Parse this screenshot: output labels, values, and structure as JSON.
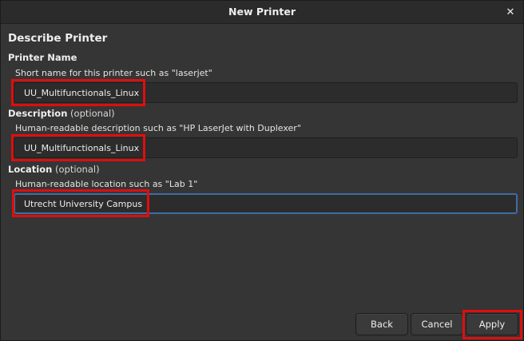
{
  "window": {
    "title": "New Printer",
    "close_symbol": "✕"
  },
  "form": {
    "heading": "Describe Printer",
    "printer_name": {
      "label": "Printer Name",
      "hint": "Short name for this printer such as \"laserjet\"",
      "value": "UU_Multifunctionals_Linux"
    },
    "description": {
      "label": "Description",
      "optional": " (optional)",
      "hint": "Human-readable description such as \"HP LaserJet with Duplexer\"",
      "value": "UU_Multifunctionals_Linux"
    },
    "location": {
      "label": "Location",
      "optional": " (optional)",
      "hint": "Human-readable location such as \"Lab 1\"",
      "value": "Utrecht University Campus"
    }
  },
  "buttons": {
    "back": "Back",
    "cancel": "Cancel",
    "apply": "Apply"
  },
  "colors": {
    "highlight": "#e00d0d",
    "focus": "#3d6ea8",
    "background": "#353535"
  },
  "icons": {
    "close": "close-icon"
  }
}
